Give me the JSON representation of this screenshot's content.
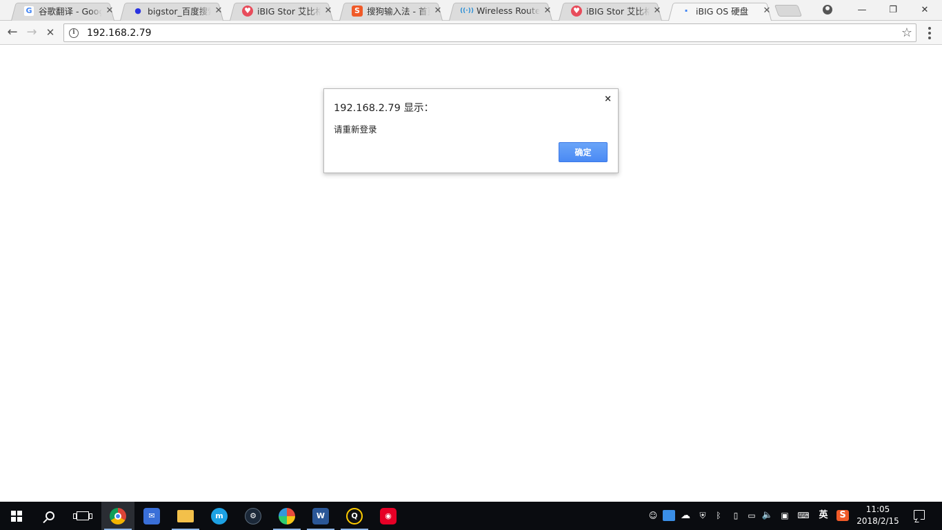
{
  "tabs": [
    {
      "title": "谷歌翻译 - Google 翻译",
      "favicon": "G",
      "favicon_color": "#4285f4",
      "favicon_name": "google-icon"
    },
    {
      "title": "bigstor_百度搜索",
      "favicon": "🐾",
      "favicon_color": "#2932e1",
      "favicon_name": "baidu-paw-icon"
    },
    {
      "title": "iBIG Stor 艾比格特",
      "favicon": "♥",
      "favicon_color": "#e84c5b",
      "favicon_name": "ibig-heart-icon"
    },
    {
      "title": "搜狗输入法 - 首页",
      "favicon": "S",
      "favicon_color": "#f05a28",
      "favicon_name": "sogou-icon"
    },
    {
      "title": "Wireless Router Firmware",
      "favicon": "((·))",
      "favicon_color": "#2a8fd6",
      "favicon_name": "wireless-icon"
    },
    {
      "title": "iBIG Stor 艾比格特",
      "favicon": "♥",
      "favicon_color": "#e84c5b",
      "favicon_name": "ibig-heart-icon"
    },
    {
      "title": "iBIG OS 硬盘",
      "favicon": "·",
      "favicon_color": "#4285f4",
      "favicon_name": "loading-icon"
    }
  ],
  "toolbar": {
    "back": "←",
    "forward": "→",
    "stop": "✕",
    "url": "192.168.2.79",
    "star": "☆"
  },
  "window_controls": {
    "minimize": "—",
    "restore": "❐",
    "close": "✕"
  },
  "dialog": {
    "title": "192.168.2.79 显示：",
    "message": "请重新登录",
    "ok_label": "确定",
    "close": "×"
  },
  "taskbar": {
    "apps": [
      "chrome",
      "mail",
      "file-explorer",
      "meitu",
      "steam",
      "colorful-app",
      "word",
      "qq",
      "netease-music"
    ],
    "tray": {
      "ime": "英",
      "sogou": "S"
    },
    "time": "11:05",
    "date": "2018/2/15"
  },
  "colors": {
    "accent": "#4a8af4",
    "taskbar": "#0a0c10"
  }
}
